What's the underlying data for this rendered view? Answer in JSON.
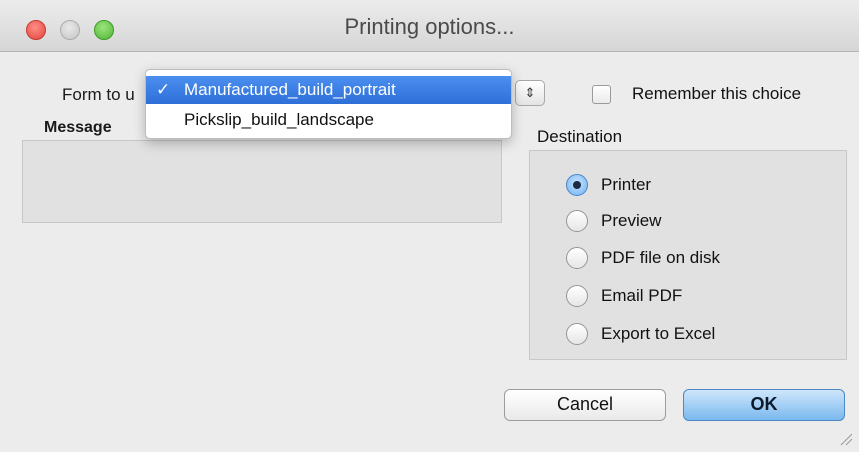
{
  "window": {
    "title": "Printing options..."
  },
  "form": {
    "label": "Form to u",
    "stepper_glyph": "⇕",
    "dropdown": {
      "options": [
        {
          "label": "Manufactured_build_portrait",
          "selected": true,
          "check": "✓"
        },
        {
          "label": "Pickslip_build_landscape",
          "selected": false
        }
      ]
    }
  },
  "message": {
    "label": "Message",
    "value": ""
  },
  "remember": {
    "label": "Remember this choice",
    "checked": false
  },
  "destination": {
    "label": "Destination",
    "options": [
      {
        "label": "Printer",
        "selected": true
      },
      {
        "label": "Preview",
        "selected": false
      },
      {
        "label": "PDF file on disk",
        "selected": false
      },
      {
        "label": "Email PDF",
        "selected": false
      },
      {
        "label": "Export to Excel",
        "selected": false
      }
    ]
  },
  "buttons": {
    "cancel": "Cancel",
    "ok": "OK"
  },
  "colors": {
    "accent": "#2d6fd8",
    "default_button": "#7ab9ee",
    "close": "#e0443a",
    "zoom": "#4fb534"
  }
}
